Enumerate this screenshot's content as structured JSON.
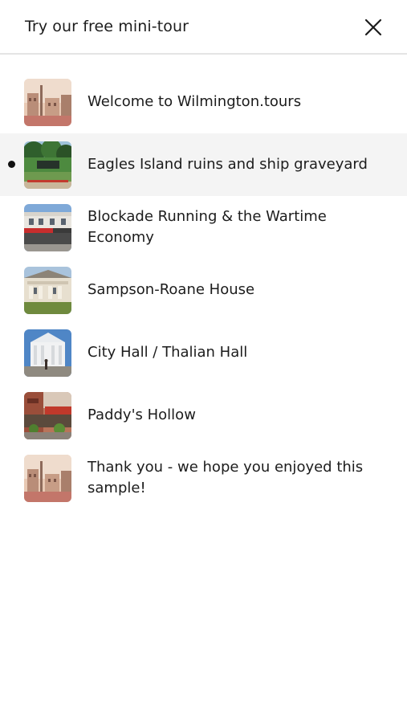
{
  "header": {
    "title": "Try our free mini-tour",
    "close_icon": "close-icon"
  },
  "stops": [
    {
      "title": "Welcome to Wilmington.tours",
      "thumbnail_icon": "sepia-street-photo",
      "active": false
    },
    {
      "title": "Eagles Island ruins and ship graveyard",
      "thumbnail_icon": "riverbank-trees-photo",
      "active": true
    },
    {
      "title": "Blockade Running & the Wartime Economy",
      "thumbnail_icon": "storefront-awnings-photo",
      "active": false
    },
    {
      "title": "Sampson-Roane House",
      "thumbnail_icon": "house-photo",
      "active": false
    },
    {
      "title": "City Hall / Thalian Hall",
      "thumbnail_icon": "columned-hall-photo",
      "active": false
    },
    {
      "title": "Paddy's Hollow",
      "thumbnail_icon": "brick-building-photo",
      "active": false
    },
    {
      "title": "Thank you - we hope you enjoyed this sample!",
      "thumbnail_icon": "sepia-street-photo",
      "active": false
    }
  ],
  "colors": {
    "active_row_bg": "#f4f4f4",
    "divider": "#e4e4e4",
    "text": "#1c1c1c"
  }
}
